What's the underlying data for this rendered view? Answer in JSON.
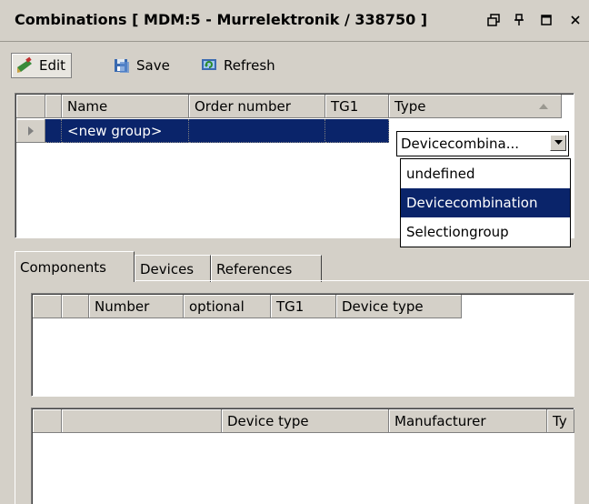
{
  "window": {
    "title": "Combinations [ MDM:5 - Murrelektronik / 338750 ]",
    "controls": [
      "restore-icon",
      "pin-icon",
      "maximize-icon",
      "close-icon"
    ]
  },
  "toolbar": {
    "edit_label": "Edit",
    "save_label": "Save",
    "refresh_label": "Refresh"
  },
  "groups_grid": {
    "columns": [
      "Name",
      "Order number",
      "TG1",
      "Type"
    ],
    "rows": [
      {
        "name": "<new group>",
        "order_number": "",
        "tg1": "",
        "type": "Devicecombina..."
      }
    ]
  },
  "type_dropdown": {
    "options": [
      "undefined",
      "Devicecombination",
      "Selectiongroup"
    ],
    "selected": "Devicecombination"
  },
  "tabs": [
    "Components",
    "Devices",
    "References"
  ],
  "components_grid": {
    "columns": [
      "Number",
      "optional",
      "TG1",
      "Device type"
    ]
  },
  "devices_grid": {
    "columns": [
      "Device type",
      "Manufacturer",
      "Ty"
    ]
  },
  "colors": {
    "selection": "#0a246a",
    "face": "#d4d0c8"
  }
}
